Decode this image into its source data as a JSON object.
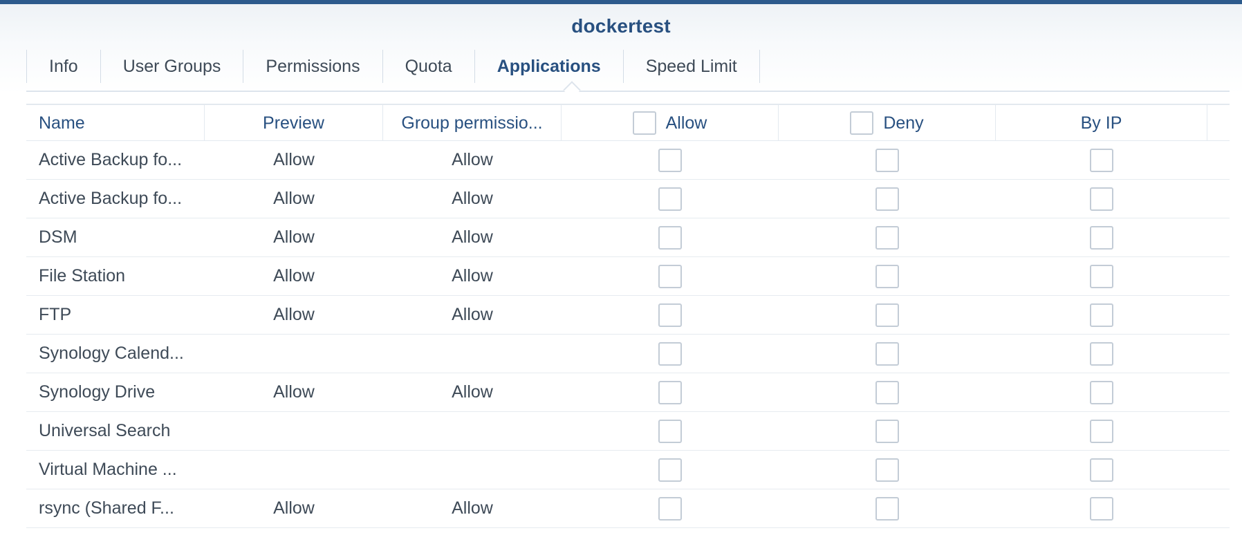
{
  "window": {
    "title": "dockertest"
  },
  "tabs": [
    {
      "label": "Info",
      "active": false
    },
    {
      "label": "User Groups",
      "active": false
    },
    {
      "label": "Permissions",
      "active": false
    },
    {
      "label": "Quota",
      "active": false
    },
    {
      "label": "Applications",
      "active": true
    },
    {
      "label": "Speed Limit",
      "active": false
    }
  ],
  "table": {
    "columns": {
      "name": "Name",
      "preview": "Preview",
      "group": "Group permissio...",
      "allow": "Allow",
      "deny": "Deny",
      "by_ip": "By IP"
    },
    "header_checks": {
      "allow": false,
      "deny": false
    },
    "rows": [
      {
        "name": "Active Backup fo...",
        "preview": "Allow",
        "group": "Allow",
        "allow": false,
        "deny": false,
        "by_ip": false
      },
      {
        "name": "Active Backup fo...",
        "preview": "Allow",
        "group": "Allow",
        "allow": false,
        "deny": false,
        "by_ip": false
      },
      {
        "name": "DSM",
        "preview": "Allow",
        "group": "Allow",
        "allow": false,
        "deny": false,
        "by_ip": false
      },
      {
        "name": "File Station",
        "preview": "Allow",
        "group": "Allow",
        "allow": false,
        "deny": false,
        "by_ip": false
      },
      {
        "name": "FTP",
        "preview": "Allow",
        "group": "Allow",
        "allow": false,
        "deny": false,
        "by_ip": false
      },
      {
        "name": "Synology Calend...",
        "preview": "",
        "group": "",
        "allow": false,
        "deny": false,
        "by_ip": false
      },
      {
        "name": "Synology Drive",
        "preview": "Allow",
        "group": "Allow",
        "allow": false,
        "deny": false,
        "by_ip": false
      },
      {
        "name": "Universal Search",
        "preview": "",
        "group": "",
        "allow": false,
        "deny": false,
        "by_ip": false
      },
      {
        "name": "Virtual Machine ...",
        "preview": "",
        "group": "",
        "allow": false,
        "deny": false,
        "by_ip": false
      },
      {
        "name": "rsync (Shared F...",
        "preview": "Allow",
        "group": "Allow",
        "allow": false,
        "deny": false,
        "by_ip": false
      }
    ]
  },
  "colors": {
    "accent": "#2c5a8c",
    "title": "#285080",
    "text": "#3e4a57",
    "border": "#e3e9ef",
    "checkbox_border": "#c3ccd6"
  }
}
